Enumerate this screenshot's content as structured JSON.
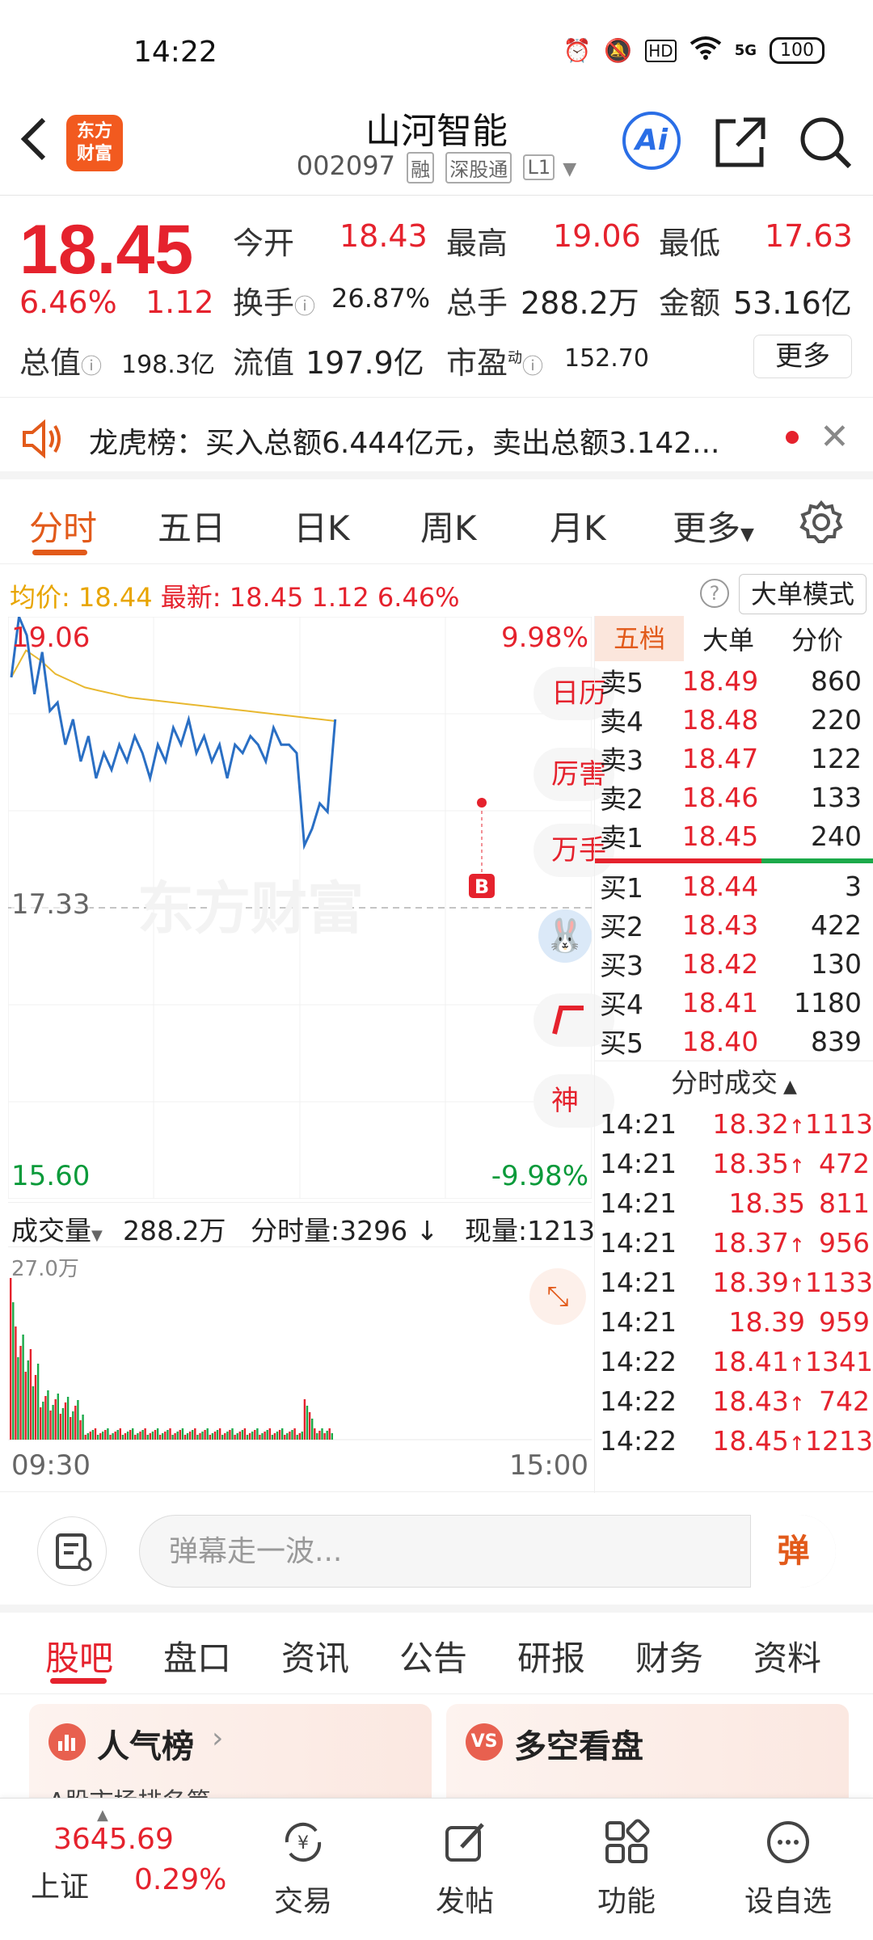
{
  "status_bar": {
    "time": "14:22",
    "battery": "100",
    "network": "5G"
  },
  "header": {
    "logo_line1": "东方",
    "logo_line2": "财富",
    "name": "山河智能",
    "code": "002097",
    "tags": [
      "融",
      "深股通",
      "L1"
    ]
  },
  "quote": {
    "price": "18.45",
    "change_pct": "6.46%",
    "change": "1.12",
    "open_label": "今开",
    "open": "18.43",
    "high_label": "最高",
    "high": "19.06",
    "low_label": "最低",
    "low": "17.63",
    "turnover_label": "换手",
    "turnover": "26.87%",
    "volume_label": "总手",
    "volume": "288.2万",
    "amount_label": "金额",
    "amount": "53.16亿",
    "total_value_label": "总值",
    "total_value": "198.3亿",
    "float_value_label": "流值",
    "float_value": "197.9亿",
    "pe_label": "市盈",
    "pe_sup": "动",
    "pe": "152.70",
    "more": "更多"
  },
  "banner": {
    "text": "龙虎榜：买入总额6.444亿元，卖出总额3.142..."
  },
  "chart_tabs": [
    "分时",
    "五日",
    "日K",
    "周K",
    "月K",
    "更多"
  ],
  "avg_row": {
    "avg_label": "均价:",
    "avg": "18.44",
    "latest_label": "最新:",
    "latest": "18.45",
    "change": "1.12",
    "change_pct": "6.46%",
    "mode_button": "大单模式"
  },
  "chart_labels": {
    "high": "19.06",
    "high_pct": "9.98%",
    "mid": "17.33",
    "low": "15.60",
    "low_pct": "-9.98%",
    "watermark": "东方财富",
    "b_marker": "B",
    "start_time": "09:30",
    "end_time": "15:00"
  },
  "side_pills": [
    "日历",
    "厉害",
    "万手",
    "",
    "",
    "神"
  ],
  "volume_header": {
    "label": "成交量",
    "total": "288.2万",
    "tick_label": "分时量:3296",
    "now_label": "现量:1213",
    "axis_max": "27.0万"
  },
  "order_book_tabs": [
    "五档",
    "大单",
    "分价"
  ],
  "asks": [
    {
      "label": "卖5",
      "price": "18.49",
      "qty": "860"
    },
    {
      "label": "卖4",
      "price": "18.48",
      "qty": "220"
    },
    {
      "label": "卖3",
      "price": "18.47",
      "qty": "122"
    },
    {
      "label": "卖2",
      "price": "18.46",
      "qty": "133"
    },
    {
      "label": "卖1",
      "price": "18.45",
      "qty": "240"
    }
  ],
  "bids": [
    {
      "label": "买1",
      "price": "18.44",
      "qty": "3"
    },
    {
      "label": "买2",
      "price": "18.43",
      "qty": "422"
    },
    {
      "label": "买3",
      "price": "18.42",
      "qty": "130"
    },
    {
      "label": "买4",
      "price": "18.41",
      "qty": "1180"
    },
    {
      "label": "买5",
      "price": "18.40",
      "qty": "839"
    }
  ],
  "trades_header": "分时成交",
  "trades": [
    {
      "time": "14:21",
      "price": "18.32",
      "dir": "↑",
      "qty": "1113"
    },
    {
      "time": "14:21",
      "price": "18.35",
      "dir": "↑",
      "qty": "472"
    },
    {
      "time": "14:21",
      "price": "18.35",
      "dir": "",
      "qty": "811"
    },
    {
      "time": "14:21",
      "price": "18.37",
      "dir": "↑",
      "qty": "956"
    },
    {
      "time": "14:21",
      "price": "18.39",
      "dir": "↑",
      "qty": "1133"
    },
    {
      "time": "14:21",
      "price": "18.39",
      "dir": "",
      "qty": "959"
    },
    {
      "time": "14:22",
      "price": "18.41",
      "dir": "↑",
      "qty": "1341"
    },
    {
      "time": "14:22",
      "price": "18.43",
      "dir": "↑",
      "qty": "742"
    },
    {
      "time": "14:22",
      "price": "18.45",
      "dir": "↑",
      "qty": "1213"
    }
  ],
  "danmu": {
    "placeholder": "弹幕走一波...",
    "send": "弹"
  },
  "sub_tabs": [
    "股吧",
    "盘口",
    "资讯",
    "公告",
    "研报",
    "财务",
    "资料"
  ],
  "cards": [
    {
      "title": "人气榜",
      "sub": "A股市场排名第"
    },
    {
      "title": "多空看盘",
      "sub": ""
    }
  ],
  "bottom_nav": {
    "index_value": "3645.69",
    "index_name": "上证",
    "index_change": "0.29%",
    "items": [
      "交易",
      "发帖",
      "功能",
      "设自选"
    ]
  },
  "chart_data": {
    "type": "line",
    "x_start": "09:30",
    "x_end": "15:00",
    "ylim": [
      15.6,
      19.06
    ],
    "series": [
      {
        "values": [
          18.7,
          19.06,
          18.95,
          18.6,
          18.85,
          18.5,
          18.55,
          18.3,
          18.45,
          18.2,
          18.35,
          18.1,
          18.25,
          18.15,
          18.3,
          18.2,
          18.35,
          18.25,
          18.1,
          18.3,
          18.2,
          18.4,
          18.3,
          18.45,
          18.25,
          18.35,
          18.2,
          18.3,
          18.1,
          18.3,
          18.25,
          18.35,
          18.3,
          18.2,
          18.4,
          18.3,
          18.3,
          18.25,
          17.7,
          17.8,
          17.95,
          17.9,
          18.45
        ]
      },
      {
        "values": [
          18.7,
          18.86,
          18.8,
          18.72,
          18.68,
          18.64,
          18.62,
          18.6,
          18.58,
          18.57,
          18.56,
          18.55,
          18.54,
          18.53,
          18.52,
          18.51,
          18.5,
          18.49,
          18.48,
          18.47,
          18.46,
          18.45,
          18.44
        ]
      }
    ]
  }
}
